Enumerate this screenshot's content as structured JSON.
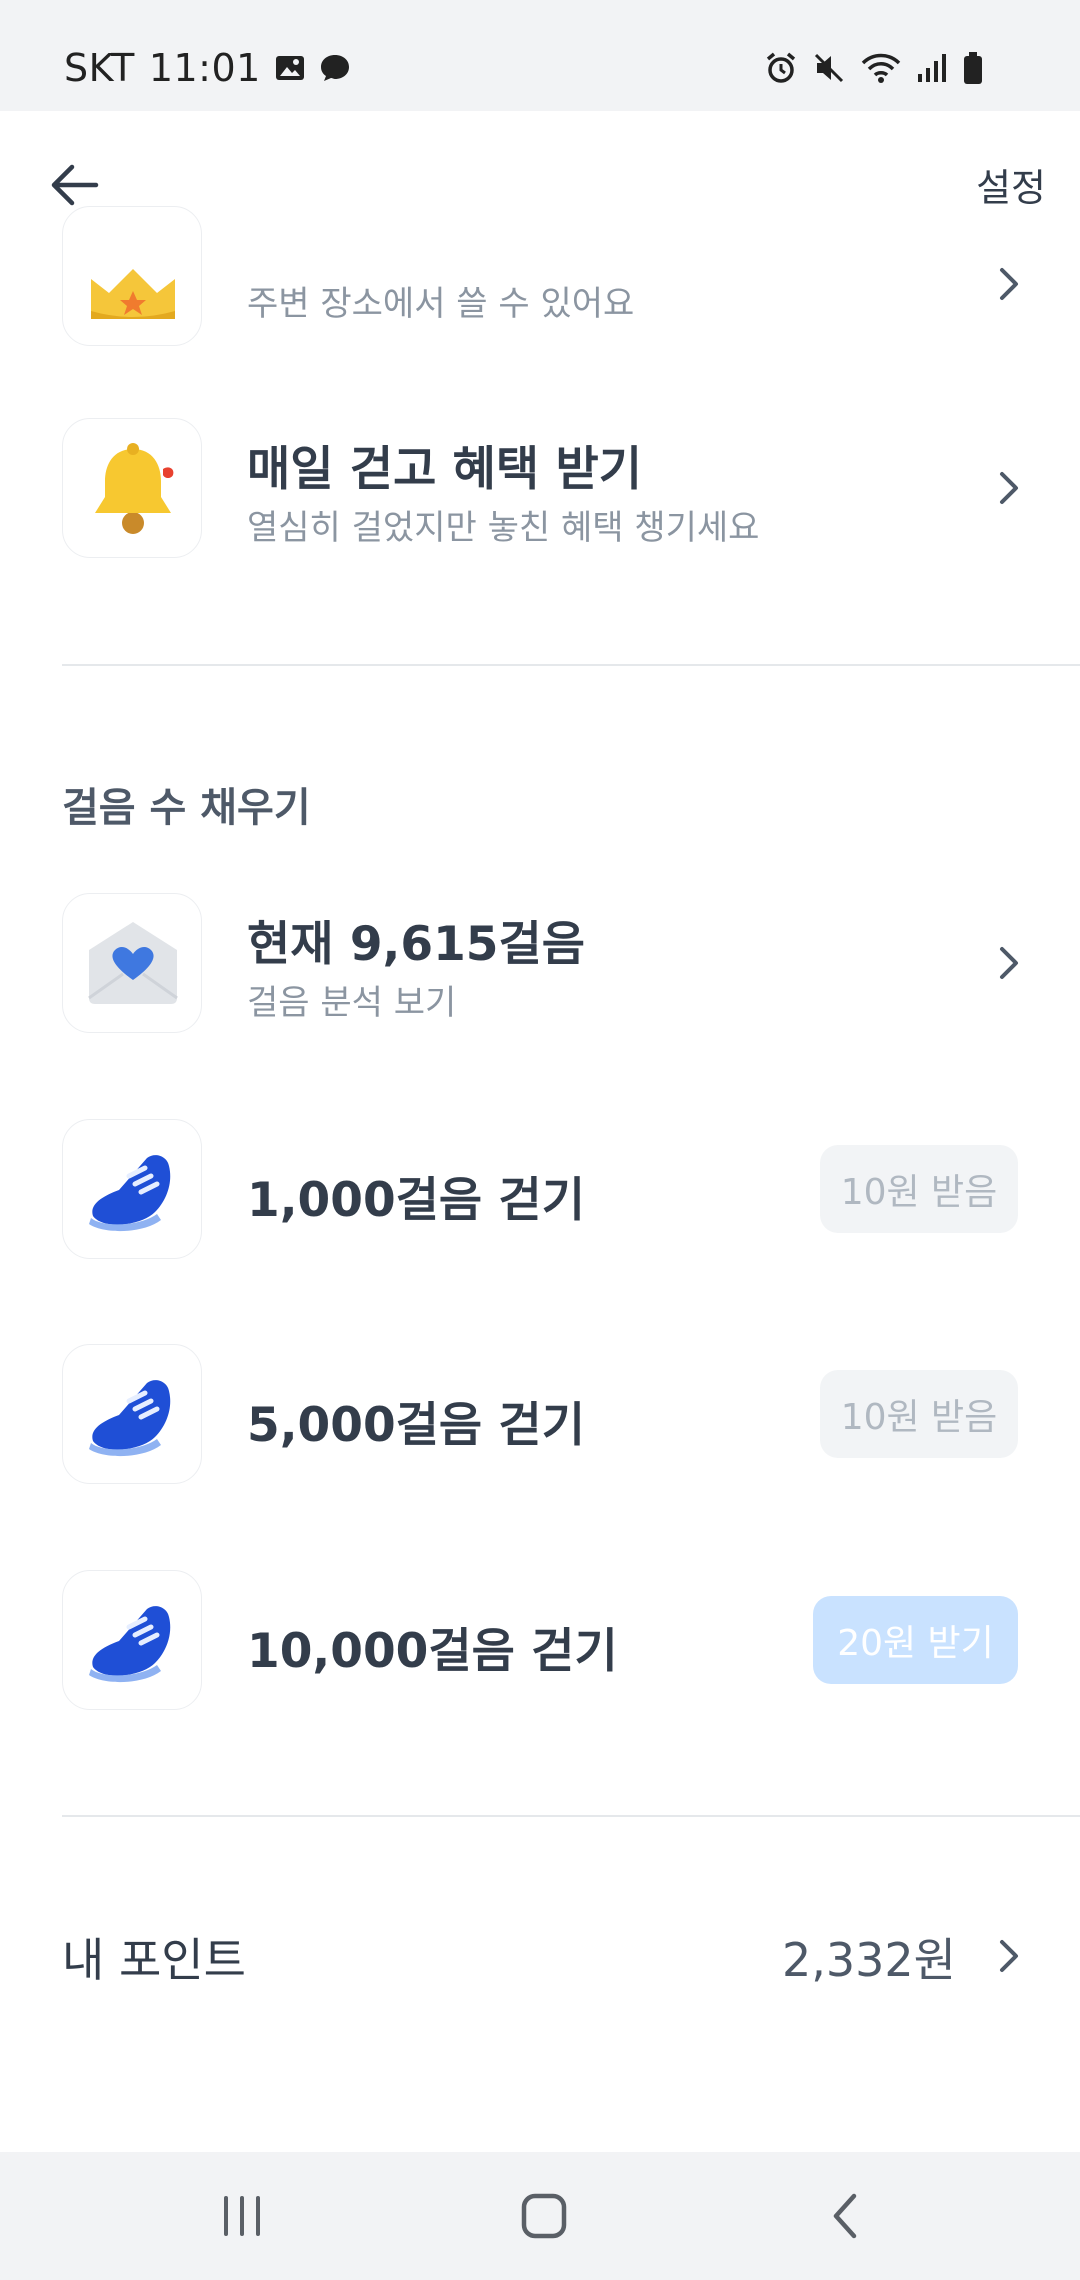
{
  "status_bar": {
    "carrier": "SKT",
    "time": "11:01"
  },
  "header": {
    "back_icon": "arrow-left-icon",
    "settings_label": "설정"
  },
  "top_items": [
    {
      "icon": "crown-icon",
      "title": "",
      "subtitle": "주변 장소에서 쓸 수 있어요"
    },
    {
      "icon": "bell-icon",
      "title": "매일 걷고 혜택 받기",
      "subtitle": "열심히 걸었지만 놓친 혜택 챙기세요"
    }
  ],
  "steps_section": {
    "title": "걸음 수 채우기",
    "current": {
      "icon": "heart-envelope-icon",
      "title": "현재 9,615걸음",
      "subtitle": "걸음 분석 보기"
    },
    "goals": [
      {
        "icon": "shoe-icon",
        "title": "1,000걸음 걷기",
        "button": "10원 받음",
        "state": "received"
      },
      {
        "icon": "shoe-icon",
        "title": "5,000걸음 걷기",
        "button": "10원 받음",
        "state": "received"
      },
      {
        "icon": "shoe-icon",
        "title": "10,000걸음 걷기",
        "button": "20원 받기",
        "state": "available"
      }
    ]
  },
  "points": {
    "label": "내 포인트",
    "value": "2,332원"
  },
  "colors": {
    "text_primary": "#333d4b",
    "text_secondary": "#8b95a1",
    "received_bg": "#f2f4f6",
    "available_bg": "#c9e2ff"
  }
}
